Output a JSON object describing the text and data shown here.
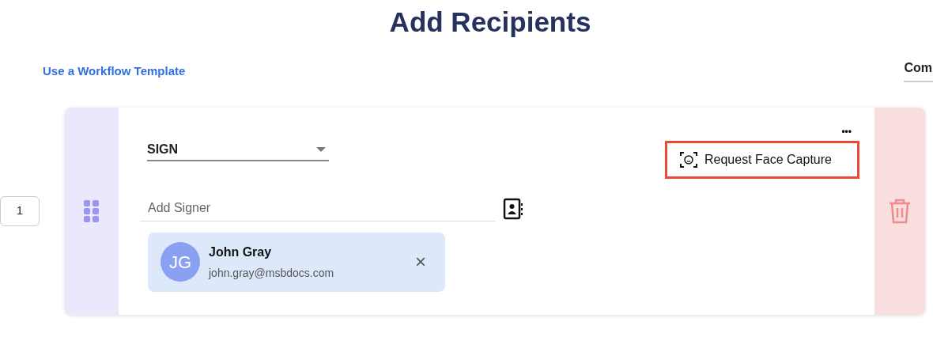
{
  "title": "Add Recipients",
  "template_link": "Use a Workflow Template",
  "tab_cut": "Com",
  "recipients": [
    {
      "order": "1",
      "action": "SIGN",
      "signer_placeholder": "Add Signer",
      "more": "•••",
      "face_capture": {
        "label": "Request Face Capture",
        "highlighted": true
      },
      "signers": [
        {
          "initials": "JG",
          "name": "John Gray",
          "email": "john.gray@msbdocs.com",
          "remove": "×"
        }
      ]
    }
  ]
}
